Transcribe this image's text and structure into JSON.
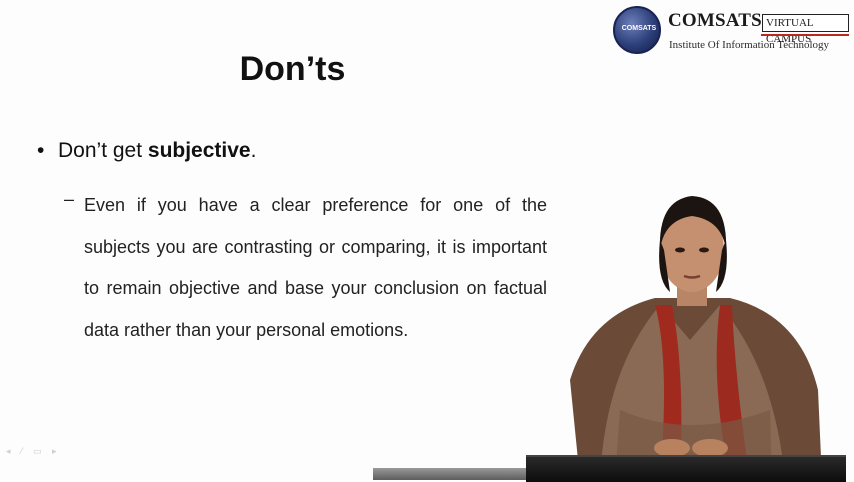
{
  "logo": {
    "emblem_text": "COMSATS",
    "name": "COMSATS",
    "badge": "VIRTUAL CAMPUS",
    "subtitle": "Institute Of Information Technology"
  },
  "slide": {
    "title": "Don’ts",
    "bullet": {
      "marker": "•",
      "prefix": "Don’t get ",
      "emphasis": "subjective",
      "suffix": "."
    },
    "sub_bullet": {
      "marker": "–",
      "text": "Even if you have a clear preference for one of the subjects you are contrasting or comparing, it is important to remain objective and base your conclusion on factual data rather than your personal emotions."
    }
  },
  "colors": {
    "background": "#fdfdfd",
    "text": "#111111",
    "logo_blue": "#2d3f7a",
    "logo_red": "#c0261c"
  },
  "icons": [
    "presenter-figure",
    "slide-nav-controls"
  ]
}
